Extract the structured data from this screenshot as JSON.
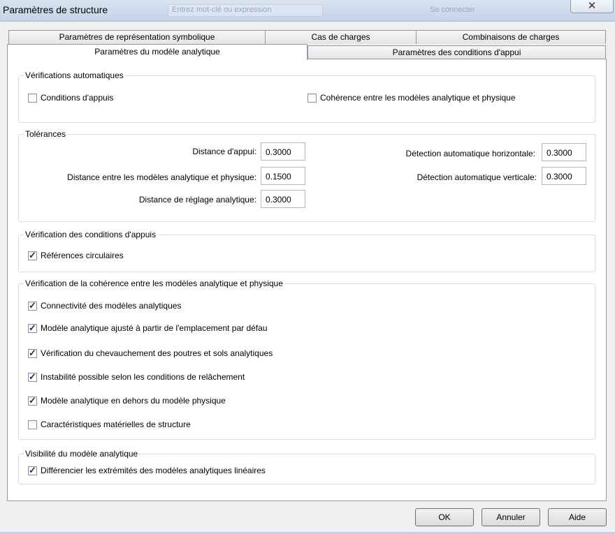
{
  "window": {
    "title": "Paramètres de structure",
    "close_glyph": "✕",
    "background_hints": [
      "Entrez mot-clé ou expression",
      "Se connecter"
    ]
  },
  "tabs": {
    "row1": [
      "Paramètres de représentation symbolique",
      "Cas de charges",
      "Combinaisons de charges"
    ],
    "row2_active": "Paramètres du modèle analytique",
    "row2_other": "Paramètres des conditions d'appui"
  },
  "auto_checks": {
    "title": "Vérifications automatiques",
    "items": [
      {
        "label": "Conditions d'appuis",
        "checked": false
      },
      {
        "label": "Cohérence entre les modèles analytique et physique",
        "checked": false
      }
    ]
  },
  "tolerances": {
    "title": "Tolérances",
    "fields": [
      {
        "label": "Distance d'appui:",
        "value": "0.3000"
      },
      {
        "label": "Distance entre les modèles analytique et physique:",
        "value": "0.1500"
      },
      {
        "label": "Distance de réglage analytique:",
        "value": "0.3000"
      },
      {
        "label": "Détection automatique horizontale:",
        "value": "0.3000"
      },
      {
        "label": "Détection automatique verticale:",
        "value": "0.3000"
      }
    ]
  },
  "support_checks": {
    "title": "Vérification des conditions d'appuis",
    "items": [
      {
        "label": "Références circulaires",
        "checked": true
      }
    ]
  },
  "coherence_checks": {
    "title": "Vérification de la cohérence entre les modèles analytique et physique",
    "items": [
      {
        "label": "Connectivité des modèles analytiques",
        "checked": true
      },
      {
        "label": "Modèle analytique ajusté à partir de l'emplacement par défau",
        "checked": true
      },
      {
        "label": "Vérification du chevauchement des poutres et sols analytiques",
        "checked": true
      },
      {
        "label": "Instabilité possible selon les conditions de relâchement",
        "checked": true
      },
      {
        "label": "Modèle analytique en dehors du modèle physique",
        "checked": true
      },
      {
        "label": "Caractéristiques matérielles de structure",
        "checked": false
      }
    ]
  },
  "visibility": {
    "title": "Visibilité du modèle analytique",
    "items": [
      {
        "label": "Différencier les extrémités des modèles analytiques linéaires",
        "checked": true
      }
    ]
  },
  "buttons": {
    "ok": "OK",
    "cancel": "Annuler",
    "help": "Aide"
  },
  "check_glyph": "✓",
  "colors": {
    "accent": "#1f2e5a",
    "panel": "#ffffff",
    "window_bg": "#f0f0f0"
  }
}
